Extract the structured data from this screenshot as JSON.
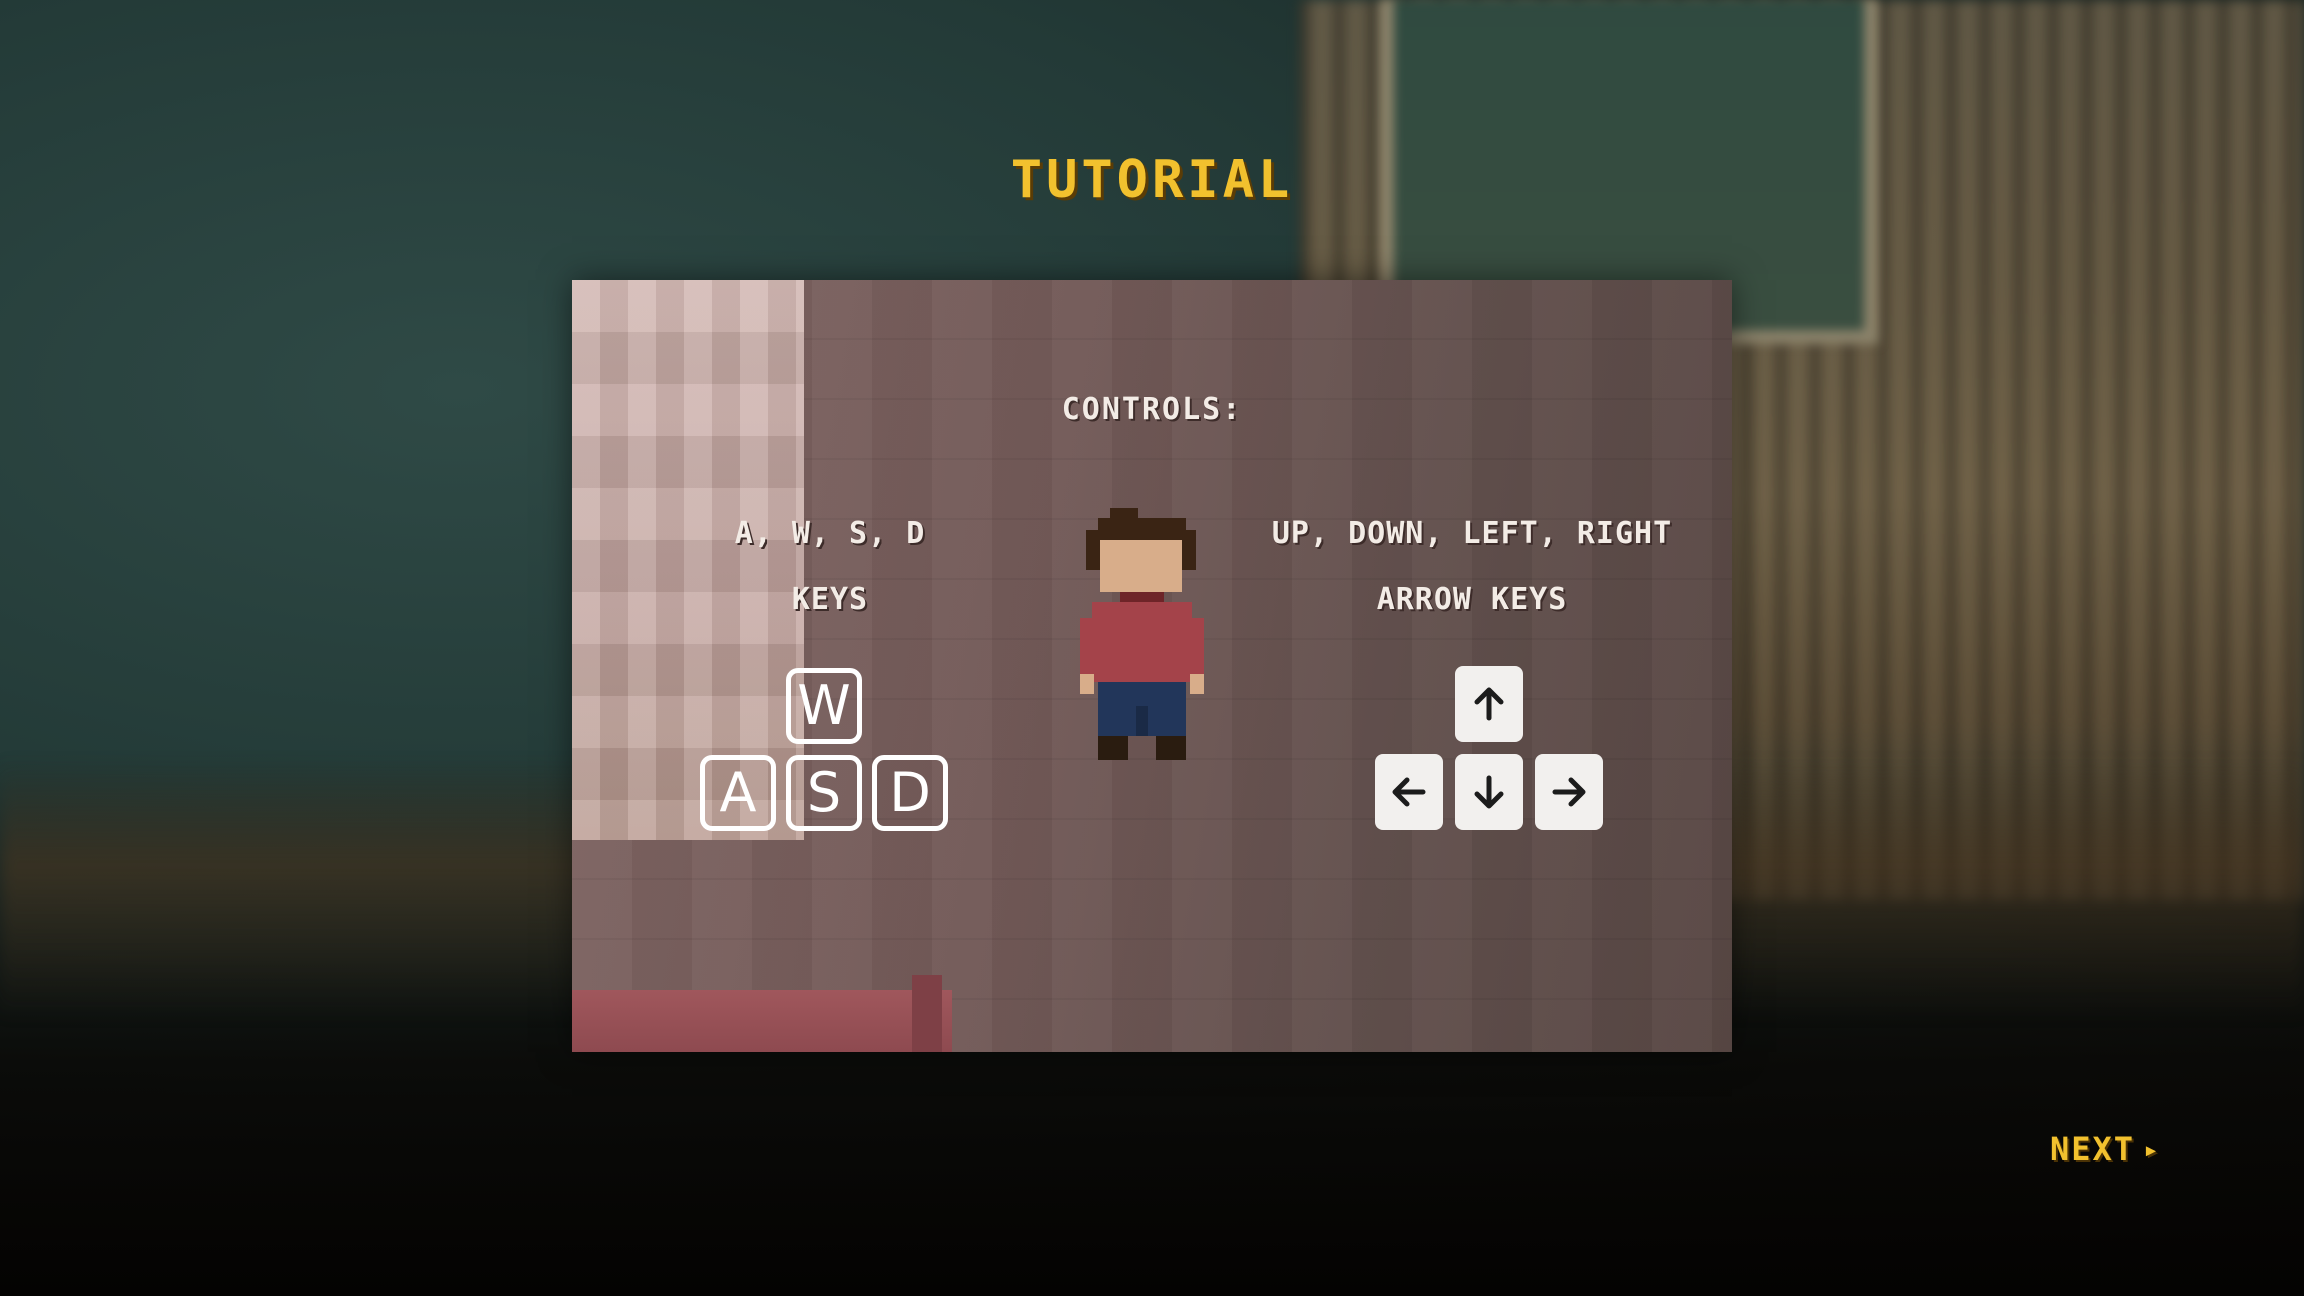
{
  "title": "TUTORIAL",
  "panel": {
    "heading": "CONTROLS:",
    "left": {
      "line1": "A, W, S, D",
      "line2": "KEYS",
      "keys": {
        "w": "W",
        "a": "A",
        "s": "S",
        "d": "D"
      }
    },
    "right": {
      "line1": "UP, DOWN, LEFT, RIGHT",
      "line2": "ARROW KEYS",
      "icons": {
        "up": "arrow-up-icon",
        "down": "arrow-down-icon",
        "left": "arrow-left-icon",
        "right": "arrow-right-icon"
      }
    }
  },
  "next": {
    "label": "NEXT",
    "icon": "play-triangle-icon"
  },
  "colors": {
    "accent": "#f2c12e",
    "text": "#f3ece6",
    "panel": "#735a58"
  }
}
